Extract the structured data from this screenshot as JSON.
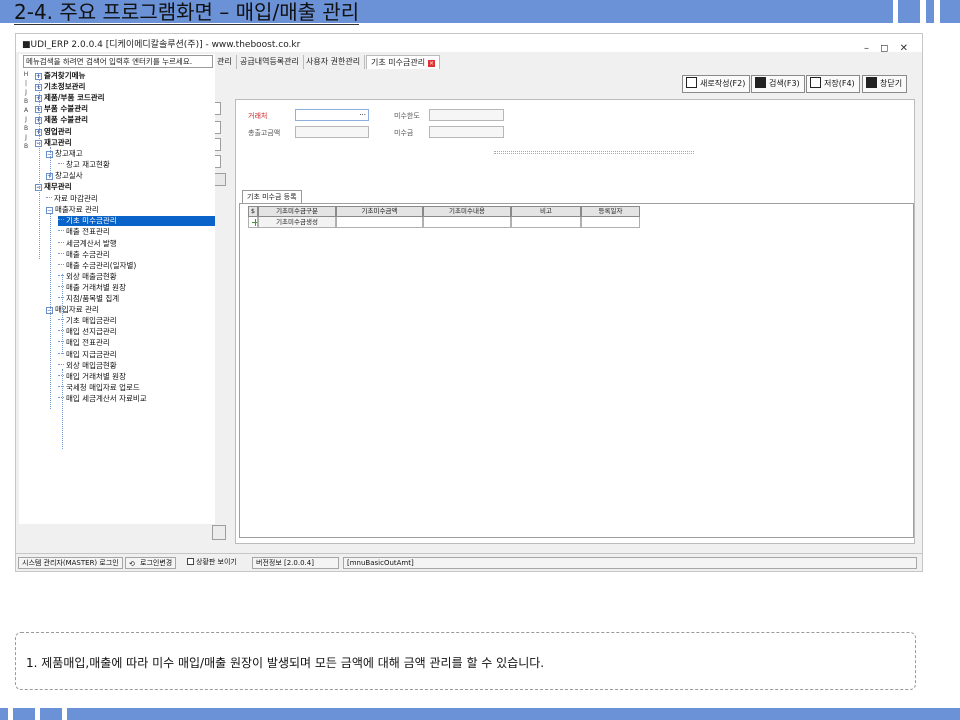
{
  "slide": {
    "title": "2-4. 주요 프로그램화면 – 매입/매출 관리",
    "note": "1.   제품매입,매출에 따라 미수 매입/매출 원장이 발생되며 모든 금액에 대해 금액 관리를 할 수 있습니다."
  },
  "window": {
    "title": "■UDI_ERP 2.0.0.4 [디케이메디칼솔루션(주)] - www.theboost.co.kr",
    "controls": "– ◻ ✕"
  },
  "tabs": [
    "관리",
    "공급내역등록관리",
    "사용자 권한관리",
    "기초 미수금관리"
  ],
  "tab_close": "×",
  "toolbar": {
    "new": "새로작성(F2)",
    "search": "검색(F3)",
    "save": "저장(F4)",
    "close": "창닫기"
  },
  "tree": {
    "search_placeholder": "메뉴검색을 하려면 검색어 입력후 엔터키를 누르세요.",
    "side": [
      "H",
      "|",
      "J",
      "B",
      "A",
      "J",
      "B",
      "J",
      "B"
    ],
    "items": [
      {
        "label": "즐겨찾기메뉴",
        "exp": "+"
      },
      {
        "label": "기초정보관리",
        "exp": "+"
      },
      {
        "label": "제품/부품 코드관리",
        "exp": "+"
      },
      {
        "label": "부품 수불관리",
        "exp": "+"
      },
      {
        "label": "제품 수불관리",
        "exp": "+"
      },
      {
        "label": "영업관리",
        "exp": "+"
      },
      {
        "label": "재고관리",
        "exp": "−"
      },
      {
        "label": "창고재고",
        "exp": "−"
      },
      {
        "label": "창고 재고현황",
        "exp": ""
      },
      {
        "label": "창고실사",
        "exp": "+"
      },
      {
        "label": "재무관리",
        "exp": "−"
      },
      {
        "label": "자료 마감관리",
        "exp": ""
      },
      {
        "label": "매출자료 관리",
        "exp": "−"
      },
      {
        "label": "기초 미수금관리",
        "exp": ""
      },
      {
        "label": "매출 전표관리",
        "exp": ""
      },
      {
        "label": "세금계산서 발행",
        "exp": ""
      },
      {
        "label": "매출 수금관리",
        "exp": ""
      },
      {
        "label": "매출 수금관리(일자별)",
        "exp": ""
      },
      {
        "label": "외상 매출금현황",
        "exp": ""
      },
      {
        "label": "매출 거래처별 원장",
        "exp": ""
      },
      {
        "label": "지점/품목별 집계",
        "exp": ""
      },
      {
        "label": "매입자료 관리",
        "exp": "−"
      },
      {
        "label": "기초 매입금관리",
        "exp": ""
      },
      {
        "label": "매입 선지급관리",
        "exp": ""
      },
      {
        "label": "매입 전표관리",
        "exp": ""
      },
      {
        "label": "매입 지급금관리",
        "exp": ""
      },
      {
        "label": "외상 매입금현황",
        "exp": ""
      },
      {
        "label": "매입 거래처별 원장",
        "exp": ""
      },
      {
        "label": "국세청 매입자료 업로드",
        "exp": ""
      },
      {
        "label": "매입 세금계산서 자료비교",
        "exp": ""
      }
    ]
  },
  "form": {
    "customer_label": "거래처",
    "customer_btn": "···",
    "limit_label": "미수한도",
    "total_label": "총출고금액",
    "receivable_label": "미수금"
  },
  "grid": {
    "tab_label": "기초 미수금 등록",
    "columns": [
      "$",
      "기초미수금구분",
      "기초미수금액",
      "기초미수내용",
      "비고",
      "등록일자"
    ],
    "row": [
      "",
      "기초미수금생성",
      "",
      "",
      "",
      ""
    ]
  },
  "status": {
    "user": "시스템 관리자(MASTER) 로그인",
    "relogin": "로그인변경",
    "toggle": "상황판 보이기",
    "version": "버전정보 [2.0.0.4]",
    "form_id": "[mnuBasicOutAmt]"
  },
  "colors": {
    "accent": "#6b91d6",
    "selection": "#0a63c9",
    "required": "#d02020"
  }
}
